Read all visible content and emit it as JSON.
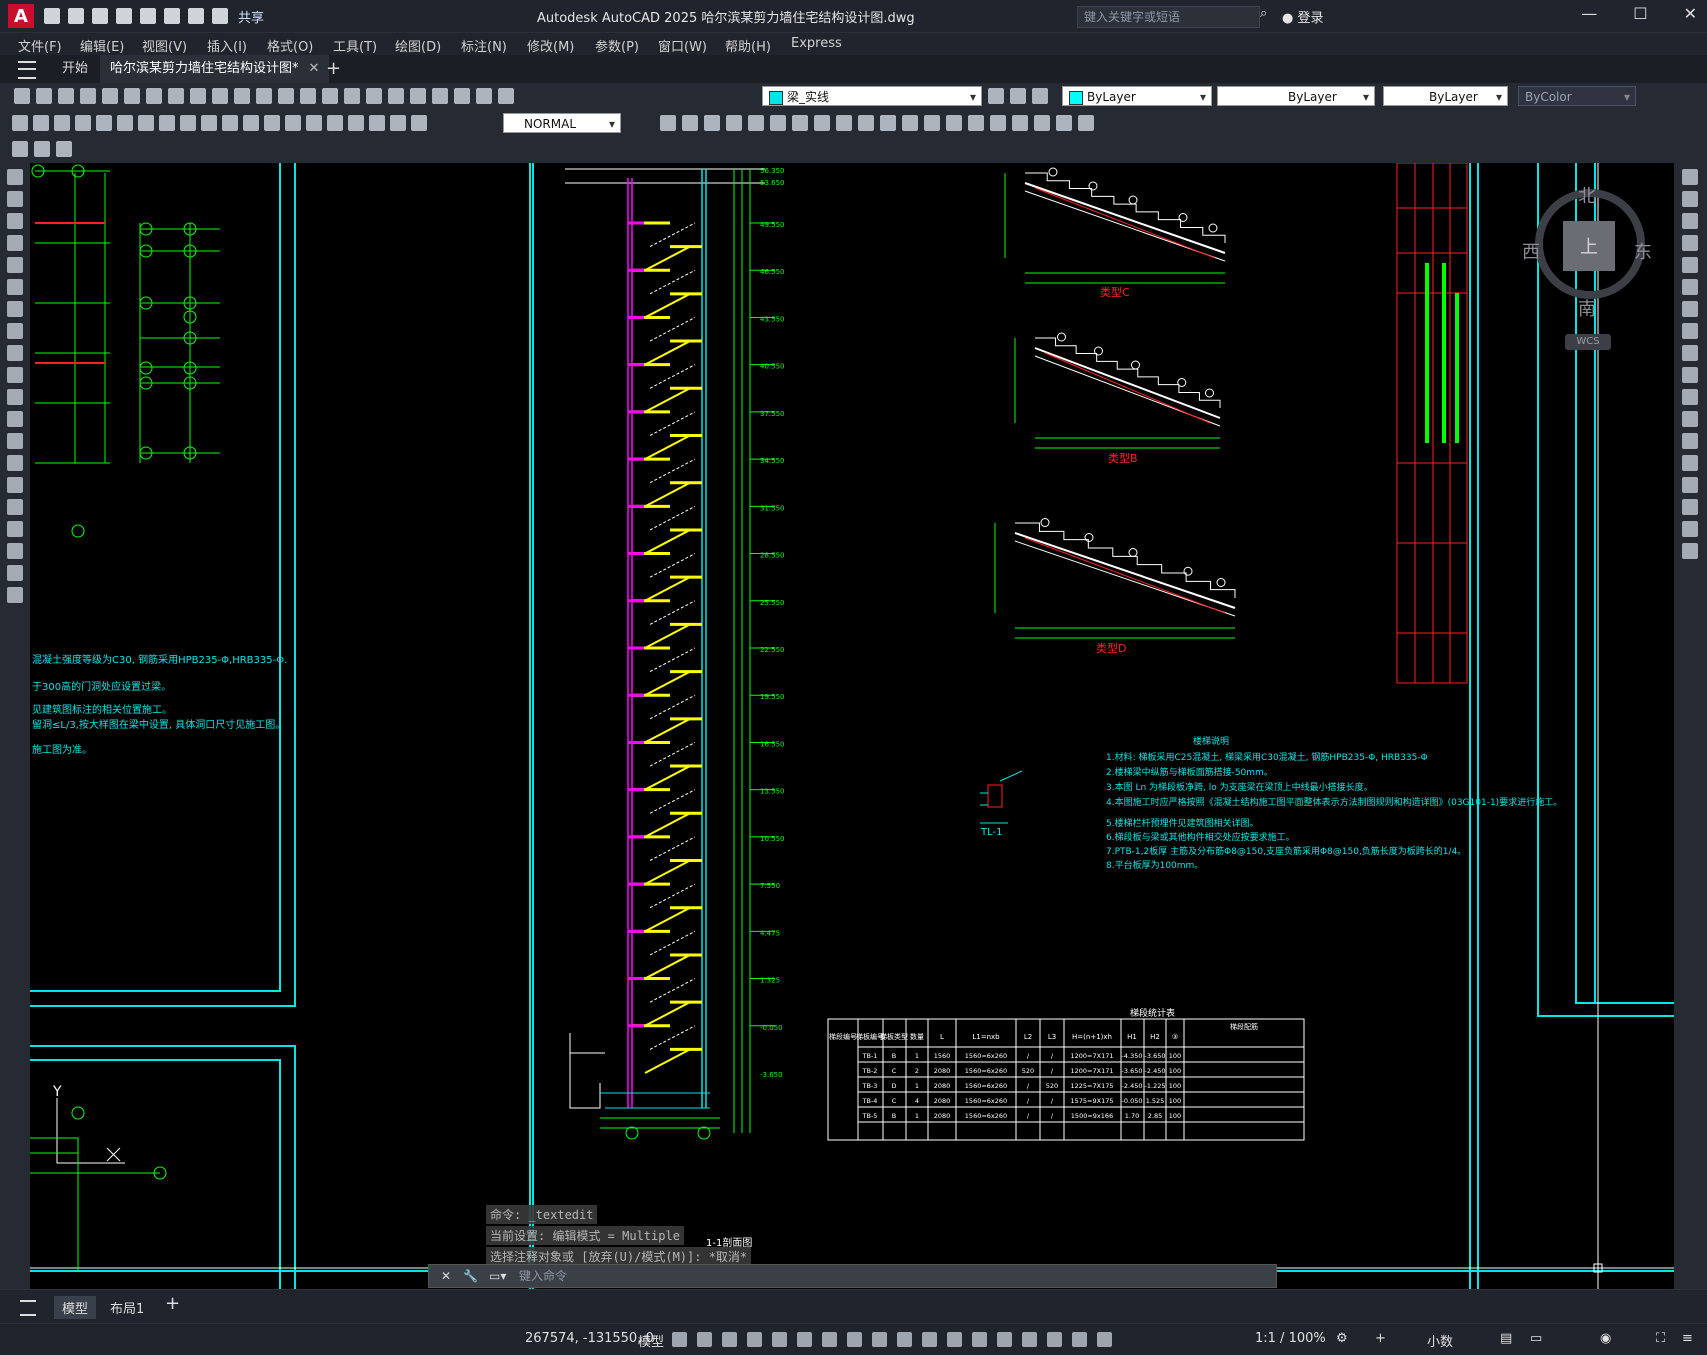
{
  "app": {
    "title": "Autodesk AutoCAD 2025    哈尔滨某剪力墙住宅结构设计图.dwg",
    "share_label": "共享",
    "search_placeholder": "键入关键字或短语",
    "login_label": "登录"
  },
  "menu": [
    "文件(F)",
    "编辑(E)",
    "视图(V)",
    "插入(I)",
    "格式(O)",
    "工具(T)",
    "绘图(D)",
    "标注(N)",
    "修改(M)",
    "参数(P)",
    "窗口(W)",
    "帮助(H)",
    "Express"
  ],
  "tabs": {
    "start": "开始",
    "active_doc": "哈尔滨某剪力墙住宅结构设计图*"
  },
  "toolbar": {
    "layer_name": "梁_实线",
    "color": "ByLayer",
    "linetype": "ByLayer",
    "lineweight": "ByLayer",
    "plotstyle": "ByColor",
    "text_style": "NORMAL"
  },
  "viewcube": {
    "north": "北",
    "south": "南",
    "west": "西",
    "east": "东",
    "face": "上",
    "wcs": "WCS"
  },
  "command": {
    "history": [
      "命令: _textedit",
      "当前设置: 编辑模式 = Multiple",
      "选择注释对象或 [放弃(U)/模式(M)]: *取消*"
    ],
    "placeholder": "键入命令"
  },
  "layouts": {
    "model": "模型",
    "layout1": "布局1"
  },
  "status": {
    "coords": "267574, -131550, 0",
    "model": "模型",
    "scale": "1:1 / 100%",
    "units": "小数"
  },
  "drawing": {
    "stair_section_title": "1-1剖面图",
    "stair_section_labels": [
      "类型C",
      "类型B",
      "类型D"
    ],
    "stair_notes_title": "楼梯说明",
    "stair_notes": [
      "1.材料: 梯板采用C25混凝土, 梯梁采用C30混凝土, 钢筋HPB235-Φ, HRB335-Φ",
      "2.楼梯梁中纵筋与梯板面筋搭接-50mm。",
      "3.本图 Ln 为梯段板净跨, lo 为支座梁在梁顶上中线最小搭接长度。",
      "4.本图施工时应严格按照《混凝土结构施工图平面整体表示方法制图规则和构造详图》(03G101-1)要求进行施工。",
      "5.楼梯栏杆预埋件见建筑图相关详图。",
      "6.梯段板与梁或其他构件相交处应按要求施工。",
      "7.PTB-1,2板厚 主筋及分布筋Φ8@150,支座负筋采用Φ8@150,负筋长度为板跨长的1/4。",
      "8.平台板厚为100mm。"
    ],
    "beam_detail_label": "TL-1",
    "table_title": "梯段统计表",
    "table_headers": [
      "梯段编号",
      "梯板编号",
      "梯板类型",
      "数量",
      "L",
      "L1=nxb",
      "L2",
      "L3",
      "H=(n+1)xh",
      "H1",
      "H2",
      "③",
      "梯段配筋"
    ],
    "table_rows": [
      [
        "TB-1",
        "B",
        "1",
        "1560",
        "1560=6x260",
        "/",
        "/",
        "1200=7X171",
        "-4.350",
        "-3.650",
        "100"
      ],
      [
        "TB-2",
        "C",
        "2",
        "2080",
        "1560=6x260",
        "520",
        "/",
        "1200=7X171",
        "-3.650",
        "-2.450",
        "100"
      ],
      [
        "TB-3",
        "D",
        "1",
        "2080",
        "1560=6x260",
        "/",
        "520",
        "1225=7X175",
        "-2.450",
        "-1.225",
        "100"
      ],
      [
        "TB-4",
        "C",
        "4",
        "2080",
        "1560=6x260",
        "/",
        "/",
        "1575=9X175",
        "-0.050",
        "1.525",
        "100"
      ],
      [
        "TB-5",
        "B",
        "1",
        "2080",
        "1560=6x260",
        "/",
        "/",
        "1500=9x166",
        "1.70",
        "2.85",
        "100"
      ]
    ],
    "elevations": [
      "56.350",
      "53.650",
      "49.550",
      "46.550",
      "43.550",
      "40.550",
      "37.550",
      "34.550",
      "31.550",
      "28.550",
      "25.550",
      "22.550",
      "19.550",
      "16.550",
      "13.550",
      "10.550",
      "7.550",
      "4.475",
      "1.325",
      "-0.050",
      "-3.650"
    ],
    "left_notes": [
      "混凝土强度等级为C30, 钢筋采用HPB235-Φ,HRB335-Φ.",
      "于300高的门洞处应设置过梁。",
      "见建筑图标注的相关位置施工。",
      "留洞≤L/3,按大样图在梁中设置, 具体洞口尺寸见施工图。",
      "施工图为准。"
    ],
    "axis_label_y": "Y"
  },
  "colors": {
    "cyan": "#00e5e5",
    "green": "#00ff00",
    "yellow": "#ffff00",
    "red": "#ff2020",
    "magenta": "#ff00ff",
    "white": "#ffffff",
    "blue": "#1e5bff"
  }
}
